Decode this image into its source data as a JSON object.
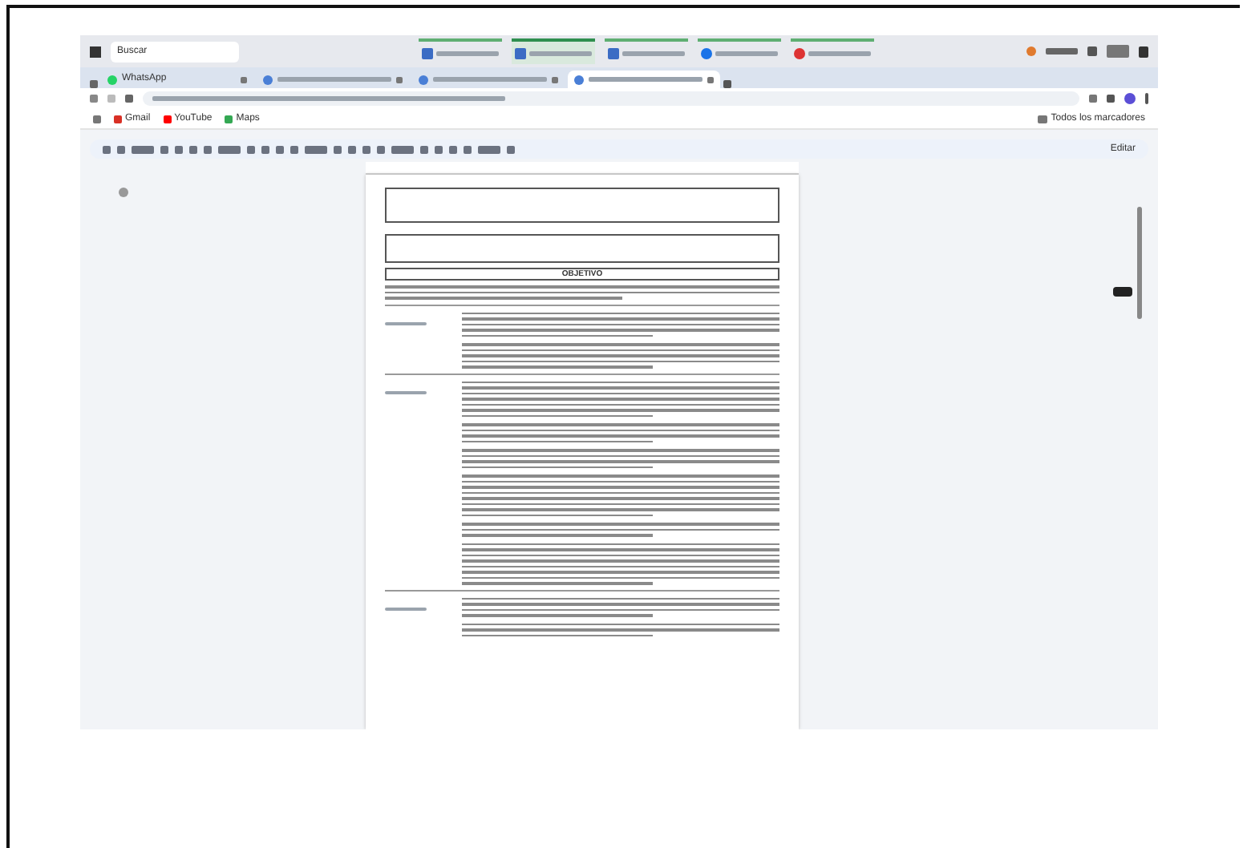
{
  "taskbar": {
    "search": "Buscar",
    "apps": [
      {
        "selected": false
      },
      {
        "selected": true
      },
      {
        "selected": false
      },
      {
        "selected": false
      },
      {
        "selected": false
      }
    ]
  },
  "tabs": [
    {
      "label": "WhatsApp",
      "selected": false
    },
    {
      "selected": false
    },
    {
      "selected": false
    },
    {
      "selected": true
    }
  ],
  "bookmarks": [
    "Gmail",
    "YouTube",
    "Maps"
  ],
  "all_bookmarks": "Todos los marcadores",
  "edit_mode": "Editar",
  "document": {
    "heading": "OBJETIVO"
  }
}
